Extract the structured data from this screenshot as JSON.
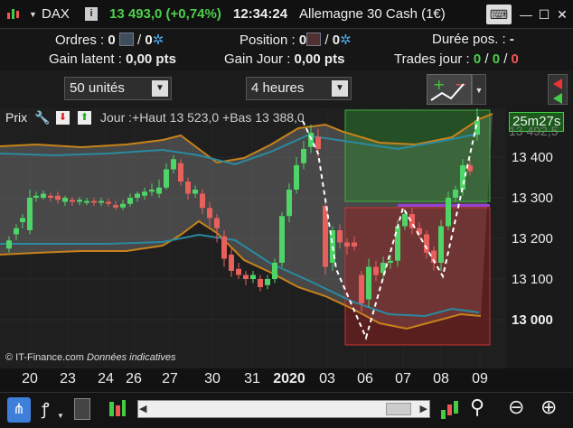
{
  "header": {
    "symbol": "DAX",
    "change": "13 493,0 (+0,74%)",
    "time": "12:34:24",
    "instrument": "Allemagne 30 Cash (1€)"
  },
  "info": {
    "orders_label": "Ordres :",
    "orders_a": "0",
    "orders_b": "0",
    "position_label": "Position :",
    "position_a": "0",
    "position_b": "0",
    "duration_label": "Durée pos. :",
    "duration_value": "-",
    "gain_latent_label": "Gain latent :",
    "gain_latent_value": "0,00 pts",
    "gain_jour_label": "Gain Jour :",
    "gain_jour_value": "0,00 pts",
    "trades_label": "Trades jour :",
    "trades_a": "0",
    "trades_b": "0",
    "trades_c": "0"
  },
  "controls": {
    "units": "50 unités",
    "timeframe": "4 heures"
  },
  "chart": {
    "price_label": "Prix",
    "day_info": "Jour :+Haut 13 523,0 +Bas 13 388,0",
    "countdown": "25m27s",
    "last_price": "13 492,5",
    "credit_brand": "© IT-Finance.com",
    "credit_note": "Données indicatives",
    "colors": {
      "up": "#4fd467",
      "down": "#e8605c",
      "band": "#c8821a",
      "mid": "#2a8aa0"
    }
  },
  "chart_data": {
    "type": "candlestick",
    "y_ticks": [
      "13 400",
      "13 300",
      "13 200",
      "13 100",
      "13 000"
    ],
    "x_ticks": [
      "20",
      "23",
      "24",
      "26",
      "27",
      "30",
      "31",
      "2020",
      "03",
      "06",
      "07",
      "08",
      "09"
    ]
  }
}
